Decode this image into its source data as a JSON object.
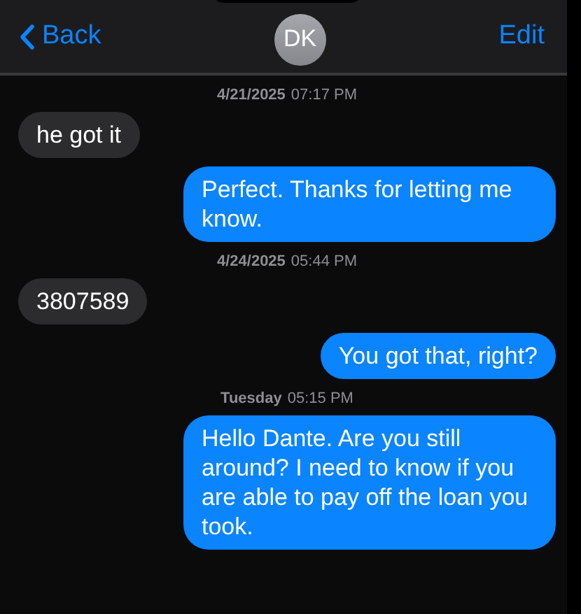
{
  "header": {
    "back": "Back",
    "avatar": "DK",
    "edit": "Edit"
  },
  "thread": [
    {
      "kind": "timestamp",
      "day": "4/21/2025",
      "time": "07:17 PM"
    },
    {
      "kind": "incoming",
      "text": "he got it"
    },
    {
      "kind": "outgoing",
      "text": "Perfect. Thanks for letting me know."
    },
    {
      "kind": "timestamp",
      "day": "4/24/2025",
      "time": "05:44 PM"
    },
    {
      "kind": "incoming",
      "text": "3807589"
    },
    {
      "kind": "outgoing",
      "text": "You got that, right?"
    },
    {
      "kind": "timestamp",
      "day": "Tuesday",
      "time": "05:15 PM"
    },
    {
      "kind": "outgoing",
      "text": "Hello Dante. Are you still around? I need to know if you are able to pay off the loan you took."
    }
  ]
}
